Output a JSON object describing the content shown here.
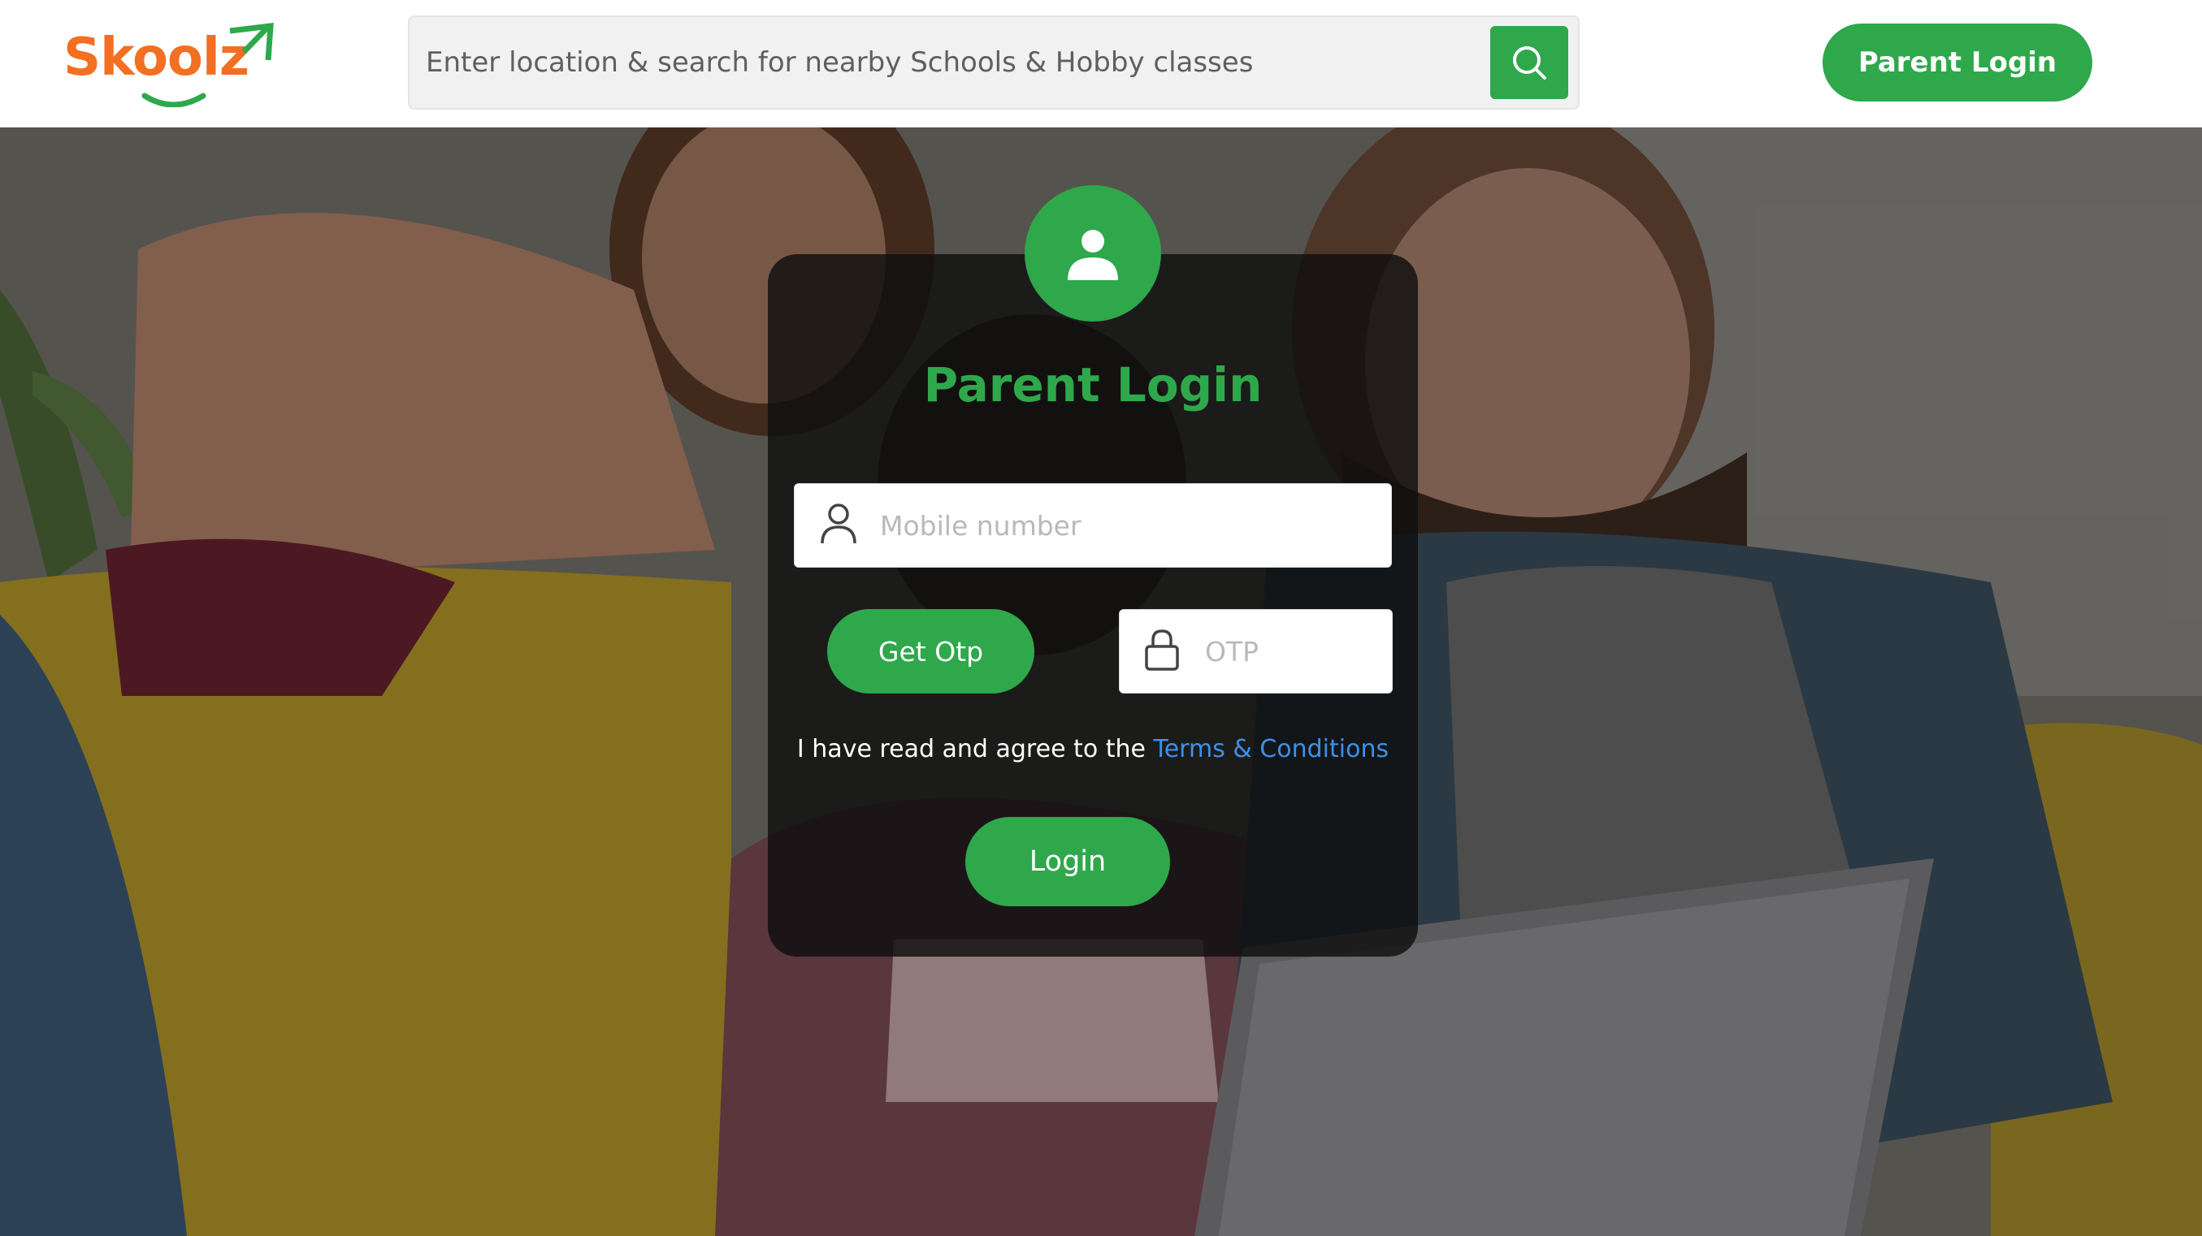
{
  "header": {
    "logo_text": "Skoolz",
    "search_placeholder": "Enter location & search for nearby Schools & Hobby classes",
    "login_label": "Parent Login"
  },
  "login_card": {
    "title": "Parent Login",
    "mobile_placeholder": "Mobile number",
    "get_otp_label": "Get Otp",
    "otp_placeholder": "OTP",
    "terms_prefix": "I have read and agree to the ",
    "terms_link": "Terms & Conditions",
    "login_label": "Login"
  },
  "colors": {
    "brand_green": "#2ea84b",
    "logo_orange": "#f36f21",
    "link_blue": "#3d8fe8"
  },
  "icons": [
    "search-icon",
    "user-avatar-icon",
    "user-outline-icon",
    "lock-icon"
  ]
}
